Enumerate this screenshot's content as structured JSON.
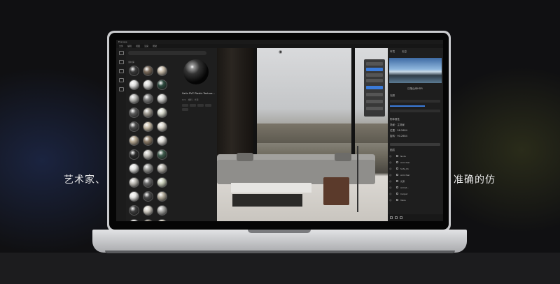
{
  "slogan": {
    "left": "艺术家、",
    "right": "准确的仿"
  },
  "app": {
    "title": "Enscape",
    "menu": [
      "文件",
      "编辑",
      "视图",
      "渲染",
      "帮助"
    ],
    "library": {
      "search_placeholder": "",
      "section_title": "素材库",
      "selected_material": {
        "name": "Satin PVC Plastic Texture...",
        "subtitle": "PVC · 塑料 · 光泽"
      },
      "swatch_colors": [
        "#3a3a3a",
        "#7a6a5a",
        "#c4b8a6",
        "#dcdcdc",
        "#d8d8d6",
        "#2d4a3e",
        "#b9b9b6",
        "#7e7e7e",
        "#cfcfcc",
        "#5a5a5a",
        "#a09b92",
        "#d2d4c8",
        "#4b4b4b",
        "#c8bda8",
        "#d7d3c9",
        "#b3a58f",
        "#8a7a66",
        "#dcdad5",
        "#2b2b2b",
        "#c5c3bd",
        "#3e5b4c",
        "#e0e0de",
        "#9a9a97",
        "#b6b3ab",
        "#bcbab4",
        "#6a6a6a",
        "#c6cbb8",
        "#e4e4e2",
        "#4a4a4a",
        "#b1aa9a",
        "#3c3c3c",
        "#d1cdc4",
        "#a9a9a6",
        "#d5d5d3",
        "#8b8375",
        "#cfc8b9"
      ]
    },
    "properties": {
      "tabs": [
        "环境",
        "天空"
      ],
      "sky_label": "日落山间HDR",
      "section_label": "光照",
      "subsection": "物体属性",
      "fields": [
        "场景 · 主场景",
        "位置 · 58.2684",
        "旋转 · 90.2684"
      ],
      "tree_header": "图层",
      "tree_items": [
        "Node",
        "Armchair",
        "Sofa_01",
        "Armchair",
        "光源",
        "Armat...",
        "Carpet",
        "Table"
      ]
    }
  }
}
